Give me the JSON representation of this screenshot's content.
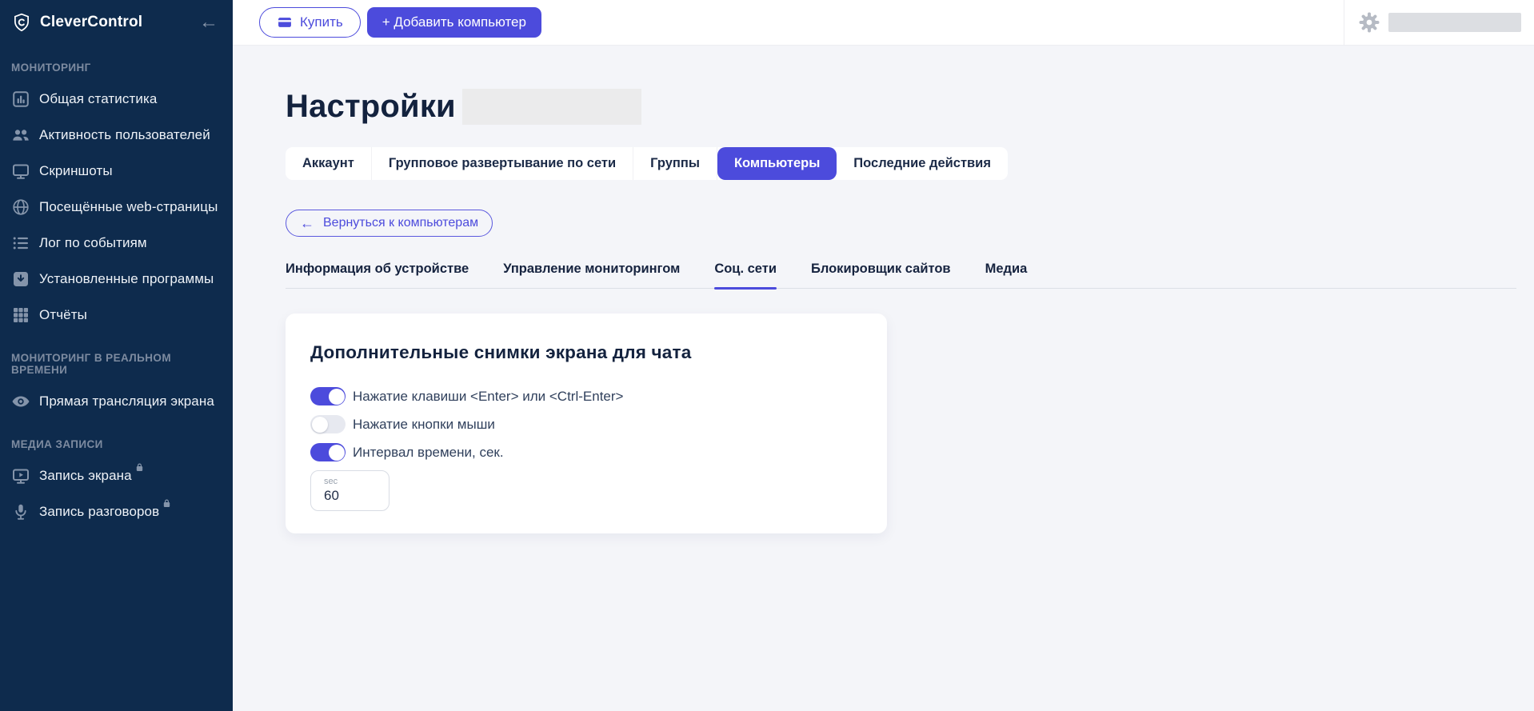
{
  "colors": {
    "accent": "#4c4bdc",
    "sidebar_bg": "#0e2b4d",
    "lock_green": "#22a83e",
    "content_bg": "#f4f5f9"
  },
  "app": {
    "name": "CleverControl",
    "logo_icon": "shield-c-icon",
    "collapse_icon": "arrow-left-icon"
  },
  "sidebar": {
    "sections": [
      {
        "label": "МОНИТОРИНГ",
        "items": [
          {
            "label": "Общая статистика",
            "icon": "bar-chart-icon"
          },
          {
            "label": "Активность пользователей",
            "icon": "users-icon"
          },
          {
            "label": "Скриншоты",
            "icon": "monitor-icon"
          },
          {
            "label": "Посещённые web-страницы",
            "icon": "globe-icon"
          },
          {
            "label": "Лог по событиям",
            "icon": "event-list-icon"
          },
          {
            "label": "Установленные программы",
            "icon": "installed-apps-icon"
          },
          {
            "label": "Отчёты",
            "icon": "grid-icon"
          }
        ]
      },
      {
        "label": "МОНИТОРИНГ В РЕАЛЬНОМ ВРЕМЕНИ",
        "items": [
          {
            "label": "Прямая трансляция экрана",
            "icon": "eye-icon"
          }
        ]
      },
      {
        "label": "МЕДИА ЗАПИСИ",
        "items": [
          {
            "label": "Запись экрана",
            "icon": "screen-record-icon",
            "locked": true,
            "badge_icon": "lock-icon"
          },
          {
            "label": "Запись разговоров",
            "icon": "microphone-icon",
            "locked": true,
            "badge_icon": "lock-icon"
          }
        ]
      }
    ]
  },
  "header": {
    "buy_button": "Купить",
    "buy_icon": "credit-card-icon",
    "add_computer_button": "+ Добавить компьютер",
    "settings_icon": "gear-icon"
  },
  "page": {
    "title": "Настройки",
    "tabs": [
      "Аккаунт",
      "Групповое развертывание по сети",
      "Группы",
      "Компьютеры",
      "Последние действия"
    ],
    "active_tab": "Компьютеры",
    "back_button": "Вернуться к компьютерам",
    "back_icon": "←",
    "subtabs": [
      "Информация об устройстве",
      "Управление мониторингом",
      "Соц. сети",
      "Блокировщик сайтов",
      "Медиа"
    ],
    "active_subtab": "Соц. сети"
  },
  "card": {
    "title": "Дополнительные снимки экрана для чата",
    "toggles": [
      {
        "label": "Нажатие клавиши <Enter> или <Ctrl-Enter>",
        "state": "on"
      },
      {
        "label": "Нажатие кнопки мыши",
        "state": "off"
      },
      {
        "label": "Интервал времени, сек.",
        "state": "on"
      }
    ],
    "interval_field": {
      "label": "sec",
      "value": "60"
    }
  }
}
